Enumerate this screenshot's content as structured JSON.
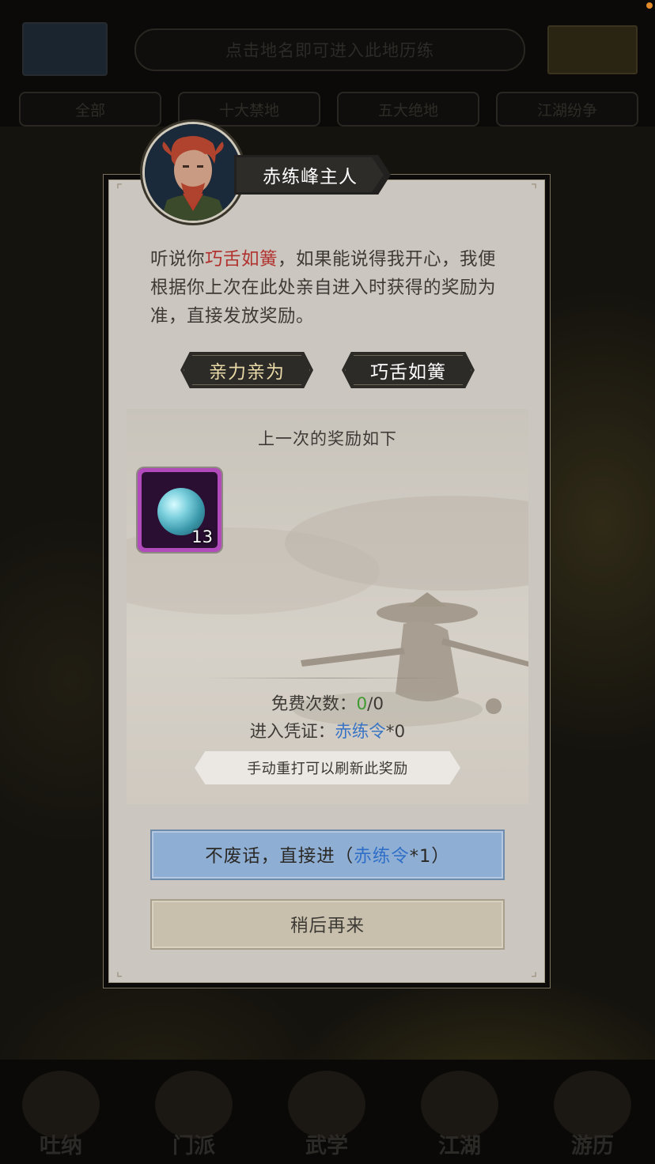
{
  "background": {
    "banner_text": "点击地名即可进入此地历练",
    "filter_tabs": [
      "全部",
      "十大禁地",
      "五大绝地",
      "江湖纷争"
    ],
    "nav": [
      "吐纳",
      "门派",
      "武学",
      "江湖",
      "游历"
    ]
  },
  "dialog": {
    "npc_name": "赤练峰主人",
    "speech": {
      "part1": "听说你",
      "highlight": "巧舌如簧",
      "part2": "，如果能说得我开心，我便根据你上次在此处亲自进入时获得的奖励为准，直接发放奖励。"
    },
    "choices": {
      "self": "亲力亲为",
      "talk": "巧舌如簧"
    },
    "reward": {
      "title": "上一次的奖励如下",
      "items": [
        {
          "icon": "cyan-crystal-orb-icon",
          "count": "13"
        }
      ],
      "free_label": "免费次数：",
      "free_used": "0",
      "free_total": "/0",
      "cert_label": "进入凭证：",
      "cert_name": "赤练令",
      "cert_count": "*0",
      "tip": "手动重打可以刷新此奖励"
    },
    "buttons": {
      "enter_prefix": "不废话，直接进（",
      "enter_token": "赤练令",
      "enter_suffix": "*1）",
      "later": "稍后再来"
    }
  },
  "colors": {
    "highlight_red": "#b1312e",
    "token_blue": "#3a75c4",
    "free_green": "#3f9a32",
    "enter_button": "#8faed4",
    "item_quality_purple": "#b14aba"
  }
}
